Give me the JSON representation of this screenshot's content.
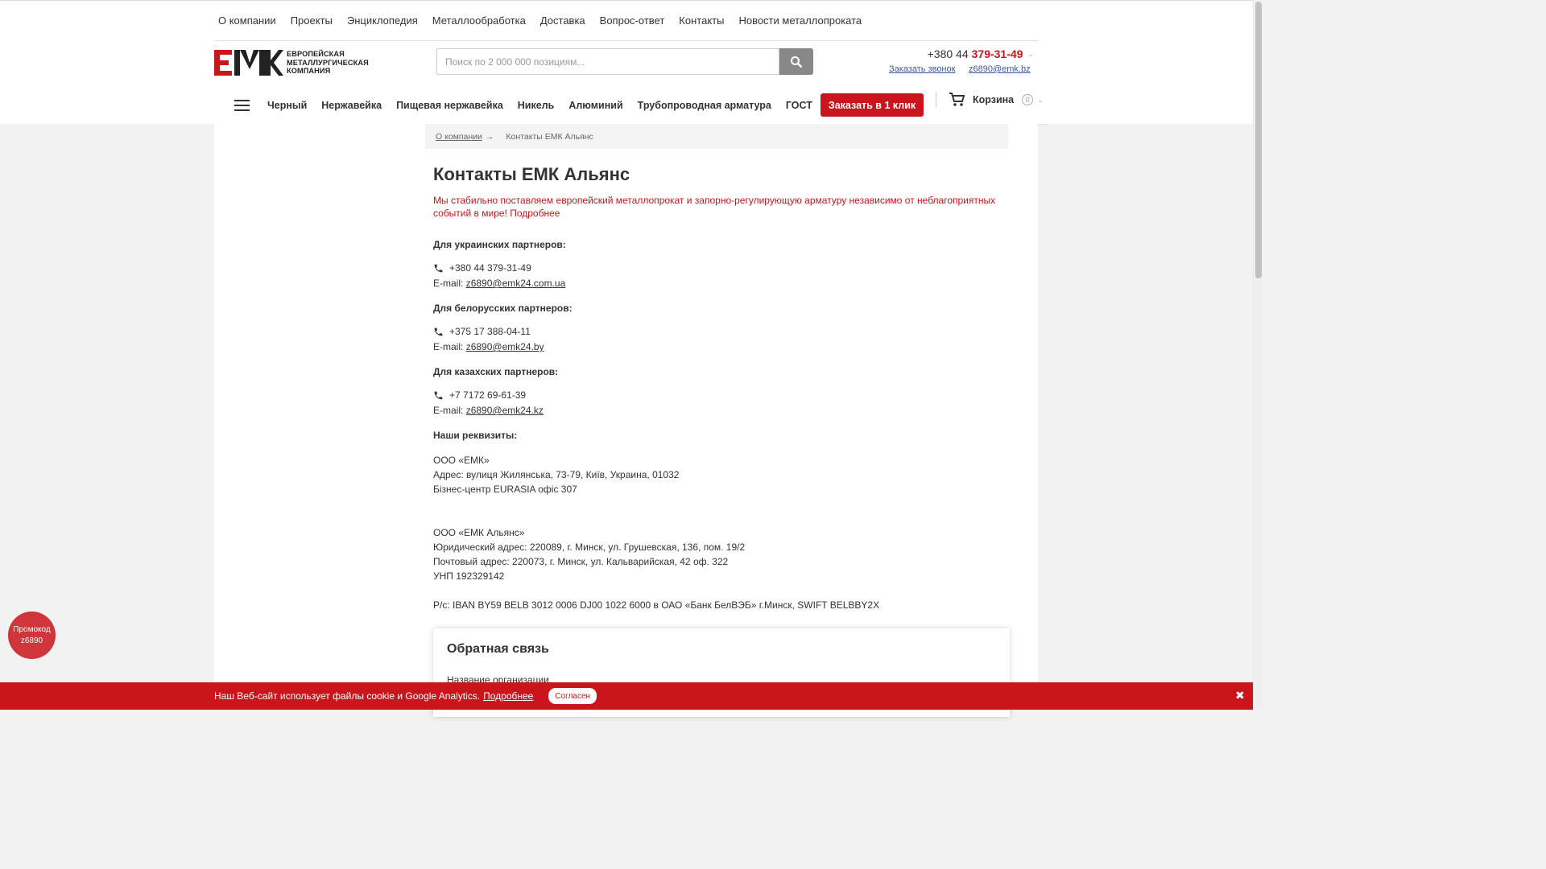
{
  "topnav": [
    "О компании",
    "Проекты",
    "Энциклопедия",
    "Металлообработка",
    "Доставка",
    "Вопрос-ответ",
    "Контакты",
    "Новости металлопроката"
  ],
  "logo": {
    "mark": "ЕМК",
    "line1": "ЕВРОПЕЙСКАЯ",
    "line2": "МЕТАЛЛУРГИЧЕСКАЯ",
    "line3": "КОМПАНИЯ"
  },
  "search": {
    "placeholder": "Поиск по 2 000 000 позициям..."
  },
  "header": {
    "phone_prefix": "+380 44",
    "phone_number": "379-31-49",
    "callback": "Заказать звонок",
    "email": "z6890@emk.bz"
  },
  "catnav": [
    "Черный",
    "Нержавейка",
    "Пищевая нержавейка",
    "Никель",
    "Алюминий",
    "Трубопроводная арматура",
    "ГОСТ"
  ],
  "oneclick": "Заказать в 1 клик",
  "cart": {
    "label": "Корзина",
    "count": "0"
  },
  "breadcrumb": {
    "parent": "О компании",
    "arrow": "→",
    "current": "Контакты ЕМК Альянс"
  },
  "page": {
    "title": "Контакты ЕМК Альянс",
    "notice": "Мы стабильно поставляем европейский металлопрокат и запорно-регулирующую арматуру независимо от неблагоприятных событий в мире! Подробнее",
    "ua_title": "Для украинских партнеров:",
    "ua_phone": "+380 44 379-31-49",
    "email_label": "E-mail:",
    "ua_email": "z6890@emk24.com.ua",
    "by_title": "Для белорусских партнеров:",
    "by_phone": "+375 17 388-04-11",
    "by_email": "z6890@emk24.by",
    "kz_title": "Для казахских партнеров:",
    "kz_phone": "+7 7172 69-61-39",
    "kz_email": "z6890@emk24.kz",
    "req_title": "Наши реквизиты:",
    "req1_name": "ООО «ЕМК»",
    "req1_addr": "Адрес: вулиця Жилянська, 73-79, Київ, Украина, 01032",
    "req1_office": "Бізнес-центр EURASIA офіс 307",
    "req2_name": "ООО «ЕМК Альянс»",
    "req2_legal": "Юридический адрес: 220089, г. Минск, ул. Грушевская, 136, пом. 19/2",
    "req2_post": "Почтовый адрес: 220073, г. Минск, ул. Кальварийская, 42 оф. 322",
    "req2_unp": "УНП 192329142",
    "req2_bank": "Р/с: IBAN BY59 BELB 3012 0006 DJ00 1022 6000 в ОАО «Банк БелВЭБ» г.Минск, SWIFT BELBBY2X"
  },
  "feedback": {
    "title": "Обратная связь",
    "field_label": "Название организации"
  },
  "promo": {
    "line1": "Промокод",
    "line2": "z6890"
  },
  "cookie": {
    "text": "Наш Веб-сайт использует файлы cookie и Google Analytics.",
    "more": "Подробнее",
    "agree": "Согласен",
    "close": "✖"
  },
  "colors": {
    "brand_red": "#c9151b",
    "link_blue": "#3b5998"
  }
}
